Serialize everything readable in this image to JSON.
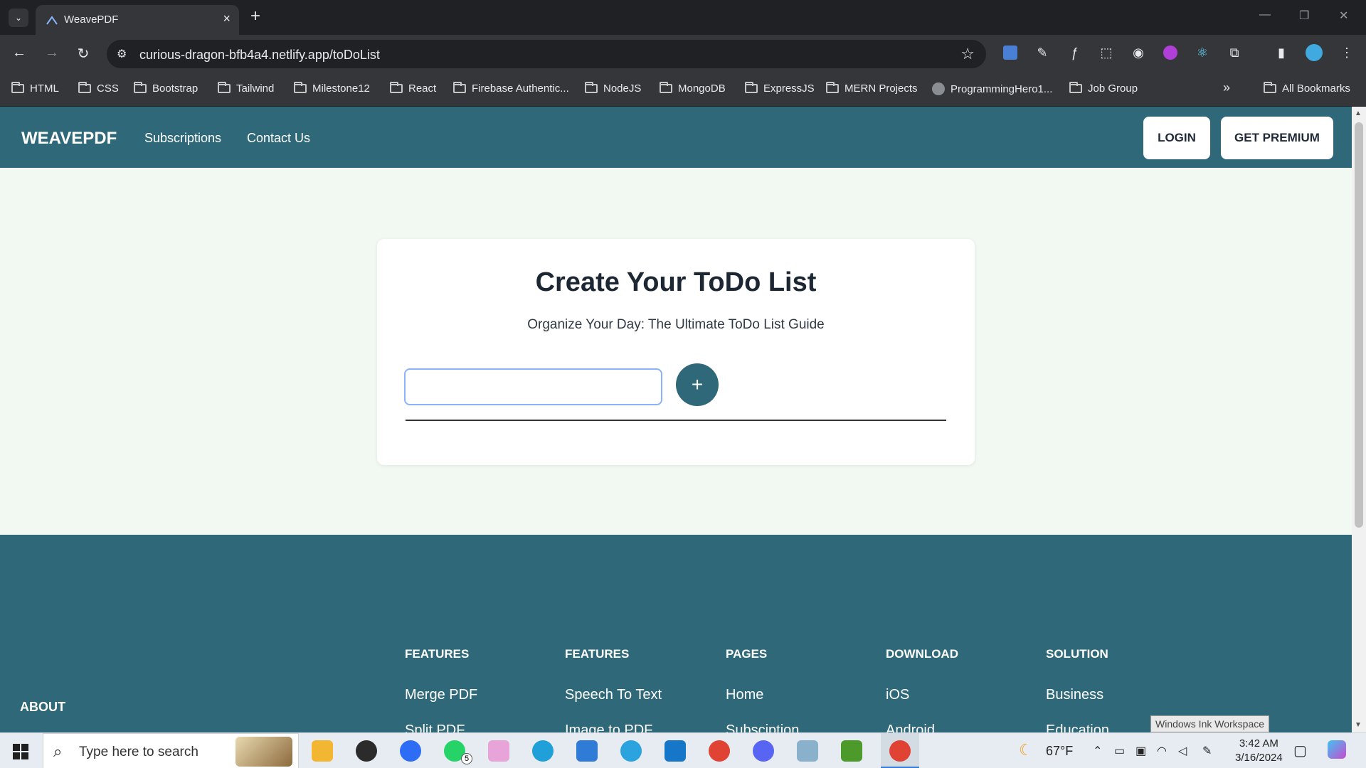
{
  "browser": {
    "tab_title": "WeavePDF",
    "url": "curious-dragon-bfb4a4.netlify.app/toDoList",
    "bookmarks": [
      "HTML",
      "CSS",
      "Bootstrap",
      "Tailwind",
      "Milestone12",
      "React",
      "Firebase Authentic...",
      "NodeJS",
      "MongoDB",
      "ExpressJS",
      "MERN Projects",
      "ProgrammingHero1...",
      "Job Group"
    ],
    "all_bookmarks": "All Bookmarks",
    "more": "»"
  },
  "site": {
    "brand": "WEAVEPDF",
    "nav": [
      "Subscriptions",
      "Contact Us"
    ],
    "login": "LOGIN",
    "premium": "GET PREMIUM",
    "accent": "#2f6878"
  },
  "todo": {
    "title": "Create Your ToDo List",
    "subtitle": "Organize Your Day: The Ultimate ToDo List Guide",
    "input_value": "",
    "add_label": "+"
  },
  "footer": {
    "about": "ABOUT",
    "columns": [
      {
        "heading": "FEATURES",
        "links": [
          "Merge PDF",
          "Split PDF"
        ]
      },
      {
        "heading": "FEATURES",
        "links": [
          "Speech To Text",
          "Image to PDF"
        ]
      },
      {
        "heading": "PAGES",
        "links": [
          "Home",
          "Subsciption"
        ]
      },
      {
        "heading": "DOWNLOAD",
        "links": [
          "iOS",
          "Android"
        ]
      },
      {
        "heading": "SOLUTION",
        "links": [
          "Business",
          "Education"
        ]
      }
    ]
  },
  "tooltip": "Windows Ink Workspace",
  "taskbar": {
    "search_placeholder": "Type here to search",
    "whatsapp_badge": "5",
    "weather": "67°F",
    "time": "3:42 AM",
    "date": "3/16/2024"
  }
}
